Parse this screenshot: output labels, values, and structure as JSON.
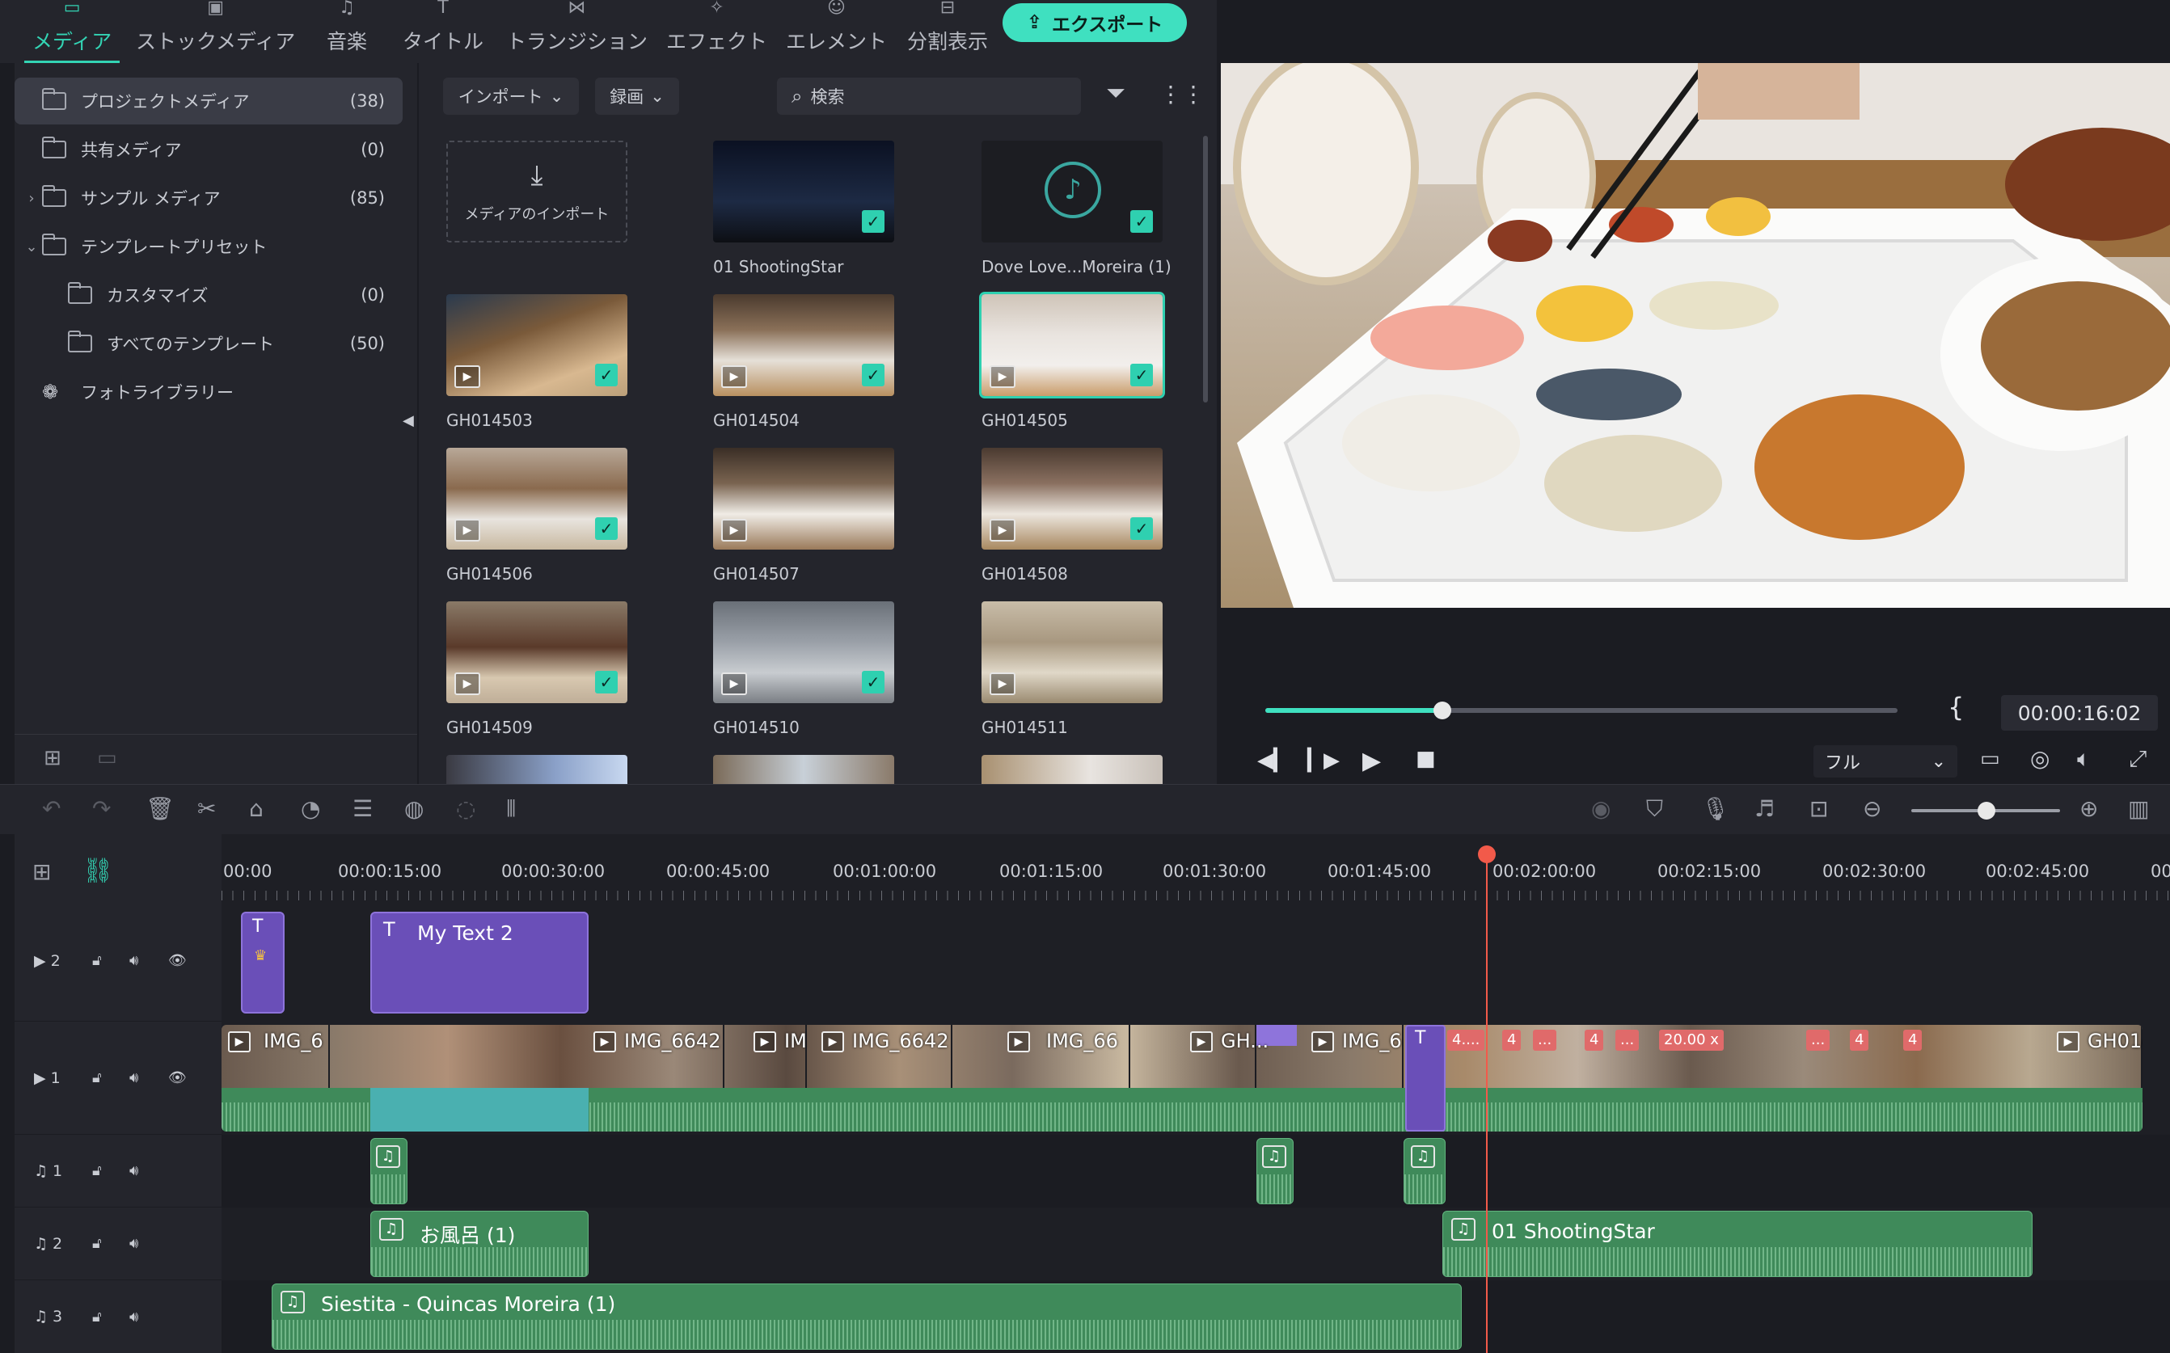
{
  "nav": {
    "tabs": [
      {
        "label": "メディア",
        "icon": "media-icon"
      },
      {
        "label": "ストックメディア",
        "icon": "stock-icon"
      },
      {
        "label": "音楽",
        "icon": "music-icon"
      },
      {
        "label": "タイトル",
        "icon": "title-icon"
      },
      {
        "label": "トランジション",
        "icon": "transition-icon"
      },
      {
        "label": "エフェクト",
        "icon": "effect-icon"
      },
      {
        "label": "エレメント",
        "icon": "element-icon"
      },
      {
        "label": "分割表示",
        "icon": "split-icon"
      }
    ],
    "export_label": "エクスポート"
  },
  "sidebar": {
    "items": [
      {
        "label": "プロジェクトメディア",
        "count": "(38)"
      },
      {
        "label": "共有メディア",
        "count": "(0)"
      },
      {
        "label": "サンプル メディア",
        "count": "(85)"
      },
      {
        "label": "テンプレートプリセット",
        "count": ""
      },
      {
        "label": "カスタマイズ",
        "count": "(0)"
      },
      {
        "label": "すべてのテンプレート",
        "count": "(50)"
      },
      {
        "label": "フォトライブラリー",
        "count": ""
      }
    ]
  },
  "media": {
    "import_btn": "インポート",
    "record_btn": "録画",
    "search_placeholder": "検索",
    "import_tile_label": "メディアのインポート",
    "items": [
      {
        "name": "01 ShootingStar"
      },
      {
        "name": "Dove Love...Moreira (1)"
      },
      {
        "name": "GH014503"
      },
      {
        "name": "GH014504"
      },
      {
        "name": "GH014505"
      },
      {
        "name": "GH014506"
      },
      {
        "name": "GH014507"
      },
      {
        "name": "GH014508"
      },
      {
        "name": "GH014509"
      },
      {
        "name": "GH014510"
      },
      {
        "name": "GH014511"
      }
    ]
  },
  "preview": {
    "timecode": "00:00:16:02",
    "quality": "フル",
    "progress": 0.28
  },
  "timeline": {
    "ticks": [
      "00:00",
      "00:00:15:00",
      "00:00:30:00",
      "00:00:45:00",
      "00:01:00:00",
      "00:01:15:00",
      "00:01:30:00",
      "00:01:45:00",
      "00:02:00:00",
      "00:02:15:00",
      "00:02:30:00",
      "00:02:45:00",
      "00"
    ],
    "tracks": [
      {
        "label": "2",
        "type": "video"
      },
      {
        "label": "1",
        "type": "video"
      },
      {
        "label": "1",
        "type": "audio"
      },
      {
        "label": "2",
        "type": "audio"
      },
      {
        "label": "3",
        "type": "audio"
      }
    ],
    "clips": {
      "title_clip": "My Text 2",
      "audio_ofuro": "お風呂 (1)",
      "audio_shooting": "01 ShootingStar",
      "audio_siestita": "Siestita - Quincas Moreira (1)",
      "video_labels": [
        "IMG_6",
        "IMG_6642",
        "IM",
        "IMG_6642",
        "IMG_66",
        "GH...",
        "IMG_6",
        "GH014"
      ],
      "speed_labels": [
        "4....",
        "4",
        "...",
        "4",
        "...",
        "20.00 x",
        "...",
        "4",
        "4"
      ]
    }
  },
  "colors": {
    "accent": "#3fe0c0",
    "title_clip": "#6a4fb8",
    "audio_clip": "#3f8a5a",
    "playhead": "#f25a4a"
  }
}
